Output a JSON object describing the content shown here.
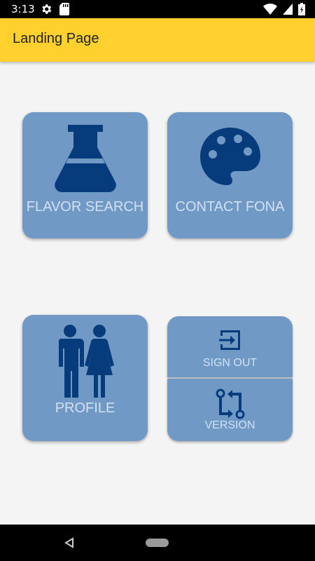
{
  "status_bar": {
    "time": "3:13",
    "icons": [
      "gear-icon",
      "sd-card-icon",
      "wifi-icon",
      "signal-icon",
      "battery-icon"
    ]
  },
  "app_bar": {
    "title": "Landing Page"
  },
  "tiles": {
    "flavor_search": {
      "label": "FLAVOR SEARCH",
      "icon": "flask-icon"
    },
    "contact_fona": {
      "label": "CONTACT FONA",
      "icon": "palette-icon"
    },
    "profile": {
      "label": "PROFILE",
      "icon": "people-icon"
    },
    "sign_out": {
      "label": "SIGN OUT",
      "icon": "exit-icon"
    },
    "version": {
      "label": "VERSION",
      "icon": "compare-arrows-icon"
    }
  },
  "colors": {
    "app_bar": "#ffd02e",
    "tile": "#7199c6",
    "icon": "#073c7c",
    "tile_text": "#d2e0f0"
  },
  "nav_bar": {
    "icons": [
      "back-icon",
      "home-pill-icon"
    ]
  }
}
